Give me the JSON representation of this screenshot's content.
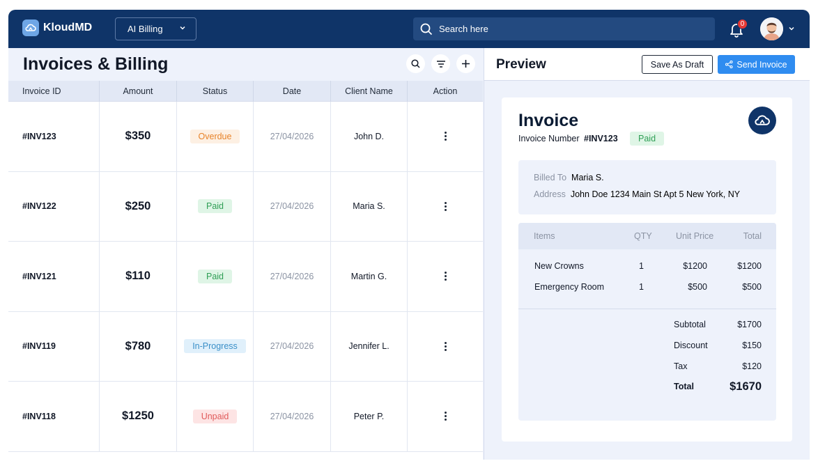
{
  "brand": {
    "name": "KloudMD"
  },
  "workspace": {
    "label": "AI Billing"
  },
  "search": {
    "placeholder": "Search here"
  },
  "notifications": {
    "count": "0"
  },
  "page": {
    "title": "Invoices & Billing"
  },
  "table": {
    "columns": [
      "Invoice ID",
      "Amount",
      "Status",
      "Date",
      "Client Name",
      "Action"
    ],
    "rows": [
      {
        "id": "#INV123",
        "amount": "$350",
        "status": "Overdue",
        "date": "27/04/2026",
        "client": "John D."
      },
      {
        "id": "#INV122",
        "amount": "$250",
        "status": "Paid",
        "date": "27/04/2026",
        "client": "Maria S."
      },
      {
        "id": "#INV121",
        "amount": "$110",
        "status": "Paid",
        "date": "27/04/2026",
        "client": "Martin G."
      },
      {
        "id": "#INV119",
        "amount": "$780",
        "status": "In-Progress",
        "date": "27/04/2026",
        "client": "Jennifer L."
      },
      {
        "id": "#INV118",
        "amount": "$1250",
        "status": "Unpaid",
        "date": "27/04/2026",
        "client": "Peter P."
      }
    ]
  },
  "status_colors": {
    "Overdue": {
      "bg": "#fdf0e3",
      "fg": "#e8832a"
    },
    "Paid": {
      "bg": "#dff5e6",
      "fg": "#2e9e55"
    },
    "In-Progress": {
      "bg": "#e0f0fb",
      "fg": "#3a8fc8"
    },
    "Unpaid": {
      "bg": "#fde4e4",
      "fg": "#e05a5a"
    }
  },
  "preview": {
    "title": "Preview",
    "save_draft": "Save As Draft",
    "send_invoice": "Send Invoice",
    "invoice": {
      "title": "Invoice",
      "number_label": "Invoice Number",
      "number": "#INV123",
      "status": "Paid",
      "billed_to_label": "Billed To",
      "billed_to": "Maria S.",
      "address_label": "Address",
      "address": "John Doe 1234 Main St Apt 5 New York, NY",
      "items_headers": {
        "items": "Items",
        "qty": "QTY",
        "unit_price": "Unit Price",
        "total": "Total"
      },
      "items": [
        {
          "name": "New Crowns",
          "qty": "1",
          "unit_price": "$1200",
          "total": "$1200"
        },
        {
          "name": "Emergency Room",
          "qty": "1",
          "unit_price": "$500",
          "total": "$500"
        }
      ],
      "subtotal_label": "Subtotal",
      "subtotal": "$1700",
      "discount_label": "Discount",
      "discount": "$150",
      "tax_label": "Tax",
      "tax": "$120",
      "total_label": "Total",
      "total": "$1670"
    }
  },
  "theme": {
    "navy": "#0f3468",
    "accent": "#2f8cf0",
    "bg": "#eef2fb"
  }
}
